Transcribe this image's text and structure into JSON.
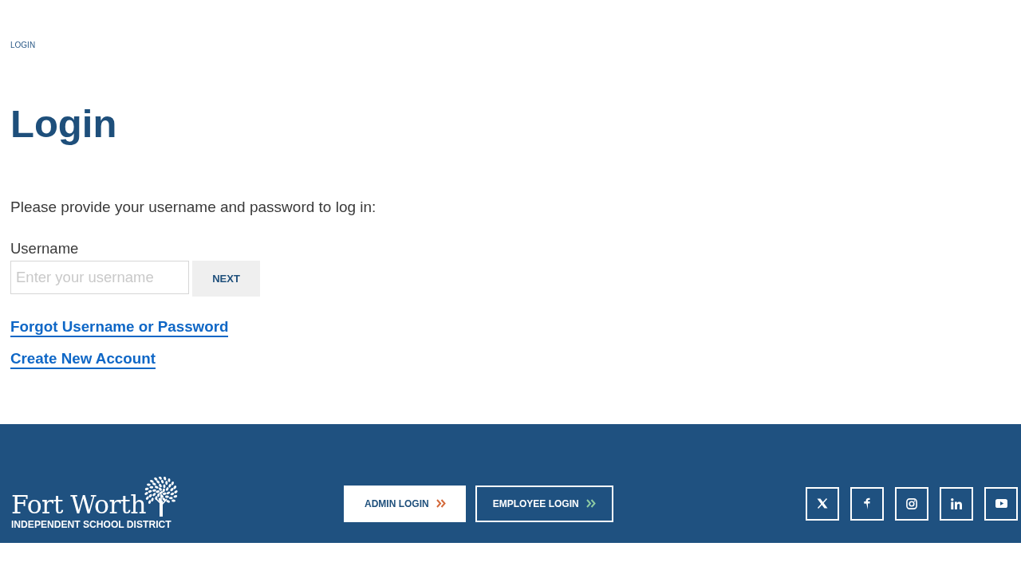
{
  "breadcrumb": [
    {
      "label": "LOGIN"
    }
  ],
  "page_title": "Login",
  "instructions": "Please provide your username and password to log in:",
  "username_field": {
    "label": "Username",
    "placeholder": "Enter your username"
  },
  "next_button": "NEXT",
  "links": [
    "Forgot Username or Password",
    "Create New Account"
  ],
  "footer": {
    "logo": {
      "name": "Fort Worth",
      "tagline": "INDEPENDENT SCHOOL DISTRICT"
    },
    "buttons": [
      {
        "label": "ADMIN LOGIN",
        "kind": "filled",
        "color": "#d4693a"
      },
      {
        "label": "EMPLOYEE LOGIN",
        "kind": "outline",
        "color": "#8ecba3"
      }
    ],
    "social": [
      {
        "kind": "x"
      },
      {
        "kind": "facebook"
      },
      {
        "kind": "instagram"
      },
      {
        "kind": "linkedin"
      },
      {
        "kind": "youtube"
      }
    ]
  }
}
